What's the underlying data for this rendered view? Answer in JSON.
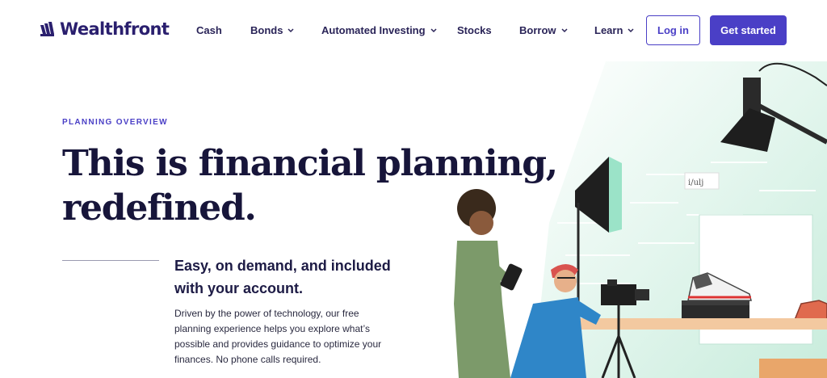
{
  "brand": {
    "name": "Wealthfront",
    "color": "#4a3fc6"
  },
  "nav": {
    "items": [
      {
        "label": "Cash",
        "has_dropdown": false
      },
      {
        "label": "Bonds",
        "has_dropdown": true
      },
      {
        "label": "Automated Investing",
        "has_dropdown": true
      },
      {
        "label": "Stocks",
        "has_dropdown": false
      },
      {
        "label": "Borrow",
        "has_dropdown": true
      },
      {
        "label": "Learn",
        "has_dropdown": true
      }
    ],
    "login_label": "Log in",
    "cta_label": "Get started"
  },
  "hero": {
    "eyebrow": "PLANNING OVERVIEW",
    "headline_line1": "This is financial planning,",
    "headline_line2": "redefined.",
    "subhead": "Easy, on demand, and included with your account.",
    "body": "Driven by the power of technology, our free planning experience helps you explore what’s possible and provides guidance to optimize your finances. No phone calls required."
  },
  "illustration": {
    "icons": [
      "woman-figure-icon",
      "photographer-figure-icon",
      "camera-icon",
      "tripod-icon",
      "softbox-light-icon",
      "studio-lamp-icon",
      "sneaker-icon",
      "shoebox-icon"
    ]
  }
}
